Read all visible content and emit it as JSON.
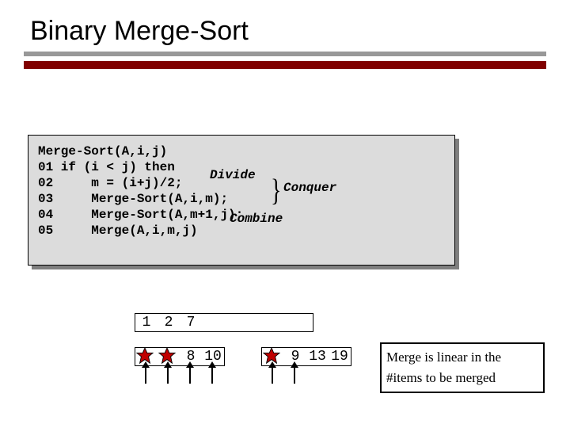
{
  "title": "Binary Merge-Sort",
  "code": {
    "l0": "Merge-Sort(A,i,j)",
    "l1": "01 if (i < j) then",
    "l2": "02     m = (i+j)/2;",
    "l3": "03     Merge-Sort(A,i,m);",
    "l4": "04     Merge-Sort(A,m+1,j);",
    "l5": "05     Merge(A,i,m,j)"
  },
  "annot": {
    "divide": "Divide",
    "conquer": "Conquer",
    "combine": "Combine"
  },
  "arrays": {
    "a1": [
      "1",
      "2",
      "7",
      "",
      "",
      "",
      "",
      ""
    ],
    "a2": [
      "",
      "",
      "8",
      "10"
    ],
    "a3": [
      "",
      "9",
      "13",
      "19"
    ]
  },
  "note": {
    "line1": "Merge is linear in the",
    "line2": "#items to be merged"
  }
}
